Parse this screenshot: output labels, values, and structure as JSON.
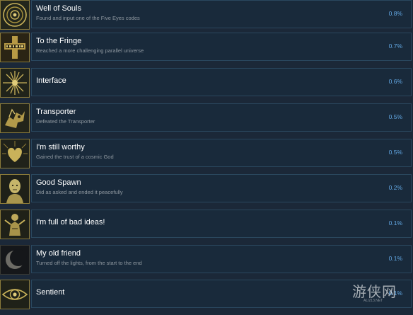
{
  "achievements": [
    {
      "title": "Well of Souls",
      "desc": "Found and input one of the Five Eyes codes",
      "pct": "0.8%",
      "icon": "eye-rings-icon"
    },
    {
      "title": "To the Fringe",
      "desc": "Reached a more challenging parallel universe",
      "pct": "0.7%",
      "icon": "fringe-cross-icon"
    },
    {
      "title": "Interface",
      "desc": "",
      "pct": "0.6%",
      "icon": "starburst-icon"
    },
    {
      "title": "Transporter",
      "desc": "Defeated the Transporter",
      "pct": "0.5%",
      "icon": "creature-icon"
    },
    {
      "title": "I'm still worthy",
      "desc": "Gained the trust of a cosmic God",
      "pct": "0.5%",
      "icon": "heart-icon"
    },
    {
      "title": "Good Spawn",
      "desc": "Did as asked and ended it peacefully",
      "pct": "0.2%",
      "icon": "face-icon"
    },
    {
      "title": "I'm full of bad ideas!",
      "desc": "",
      "pct": "0.1%",
      "icon": "figure-icon"
    },
    {
      "title": "My old friend",
      "desc": "Turned off the lights, from the start to the end",
      "pct": "0.1%",
      "icon": "crescent-moon-icon"
    },
    {
      "title": "Sentient",
      "desc": "",
      "pct": "0.1%",
      "icon": "eye-icon"
    }
  ],
  "watermark": {
    "logo": "游侠网",
    "url": "ALI213.NET"
  },
  "colors": {
    "background": "#1b2838",
    "row_background": "#192a3b",
    "row_border": "#2a475e",
    "title": "#ffffff",
    "description": "#8f98a0",
    "percent": "#62a7e3",
    "icon_gold": "#c9b25a"
  }
}
